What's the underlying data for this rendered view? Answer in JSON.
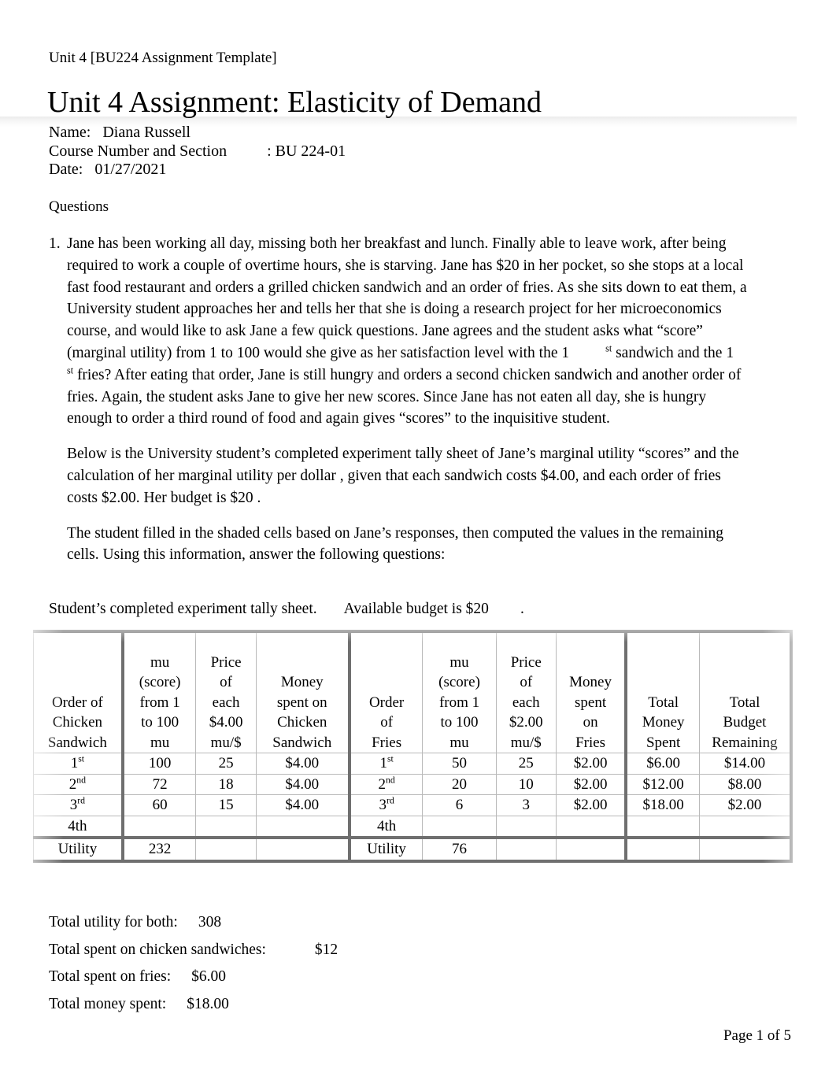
{
  "document": {
    "header_line": "Unit 4 [BU224 Assignment Template]",
    "title": "Unit 4 Assignment: Elasticity of Demand",
    "name_label": "Name:",
    "name_value": "Diana Russell",
    "course_label": "Course Number and Section",
    "course_value": ": BU 224-01",
    "date_label": "Date:",
    "date_value": "01/27/2021",
    "questions_label": "Questions",
    "footer": "Page 1 of 5"
  },
  "question": {
    "number": "1.",
    "paragraph1_a": "Jane has been working all day, missing both her breakfast and lunch. Finally able to leave work, after being required to work a couple of overtime hours, she is starving. Jane has $20 in her pocket, so she stops at a local fast food restaurant and orders a grilled chicken sandwich and an order of fries. As she sits down to eat them, a University student approaches her and tells her that she is doing a research project for her microeconomics course, and would like to ask Jane a few quick questions. Jane agrees and the student asks what “score” (marginal utility) from 1 to 100 would she give as her satisfaction level with the 1",
    "sup1": "st",
    "paragraph1_b": "sandwich and the 1",
    "sup2": "st",
    "paragraph1_c": "fries? After eating that order, Jane is still hungry and orders a second chicken sandwich and another order of fries. Again, the student asks Jane to give her new scores. Since Jane has not eaten all day, she is hungry enough to order a third round of food and again gives “scores” to the inquisitive student.",
    "paragraph2": "Below is the University student’s completed experiment tally sheet of Jane’s marginal utility “scores” and the calculation of her      marginal utility    per dollar  , given that each sandwich costs $4.00, and each order of fries costs $2.00. Her        budget is $20   .",
    "paragraph3": "The student filled in the shaded cells based on Jane’s responses, then computed the values in the remaining cells. Using this information, answer the following questions:"
  },
  "tally_caption": {
    "part1": "Student’s completed experiment tally sheet.",
    "part2": "Available budget is $20",
    "part3": "."
  },
  "table": {
    "headers": {
      "order_of_chicken_sandwich": [
        "Order of",
        "Chicken",
        "Sandwich"
      ],
      "mu_score_chicken": [
        "mu",
        "(score)",
        "from 1",
        "to 100",
        "mu"
      ],
      "price_each_chicken": [
        "Price",
        "of",
        "each",
        "$4.00",
        "mu/$"
      ],
      "money_spent_chicken": [
        "Money",
        "spent on",
        "Chicken",
        "Sandwich"
      ],
      "order_of_fries": [
        "Order",
        "of",
        "Fries"
      ],
      "mu_score_fries": [
        "mu",
        "(score)",
        "from 1",
        "to 100",
        "mu"
      ],
      "price_each_fries": [
        "Price",
        "of",
        "each",
        "$2.00",
        "mu/$"
      ],
      "money_spent_fries": [
        "Money",
        "spent",
        "on",
        "Fries"
      ],
      "total_money_spent": [
        "Total",
        "Money",
        "Spent"
      ],
      "total_budget_remaining": [
        "Total",
        "Budget",
        "Remaining"
      ]
    },
    "rows": [
      {
        "order_chicken": "1",
        "order_chicken_sup": "st",
        "mu_chicken": "100",
        "mu_per_dollar_chicken": "25",
        "money_chicken": "$4.00",
        "order_fries": "1",
        "order_fries_sup": "st",
        "mu_fries": "50",
        "mu_per_dollar_fries": "25",
        "money_fries": "$2.00",
        "total_spent": "$6.00",
        "budget_remaining": "$14.00"
      },
      {
        "order_chicken": "2",
        "order_chicken_sup": "nd",
        "mu_chicken": "72",
        "mu_per_dollar_chicken": "18",
        "money_chicken": "$4.00",
        "order_fries": "2",
        "order_fries_sup": "nd",
        "mu_fries": "20",
        "mu_per_dollar_fries": "10",
        "money_fries": "$2.00",
        "total_spent": "$12.00",
        "budget_remaining": "$8.00"
      },
      {
        "order_chicken": "3",
        "order_chicken_sup": "rd",
        "mu_chicken": "60",
        "mu_per_dollar_chicken": "15",
        "money_chicken": "$4.00",
        "order_fries": "3",
        "order_fries_sup": "rd",
        "mu_fries": "6",
        "mu_per_dollar_fries": "3",
        "money_fries": "$2.00",
        "total_spent": "$18.00",
        "budget_remaining": "$2.00"
      },
      {
        "order_chicken": "4th",
        "order_chicken_sup": "",
        "mu_chicken": "",
        "mu_per_dollar_chicken": "",
        "money_chicken": "",
        "order_fries": "4th",
        "order_fries_sup": "",
        "mu_fries": "",
        "mu_per_dollar_fries": "",
        "money_fries": "",
        "total_spent": "",
        "budget_remaining": ""
      }
    ],
    "utility_row": {
      "label_chicken": "Utility",
      "total_chicken": "232",
      "label_fries": "Utility",
      "total_fries": "76"
    }
  },
  "totals": {
    "utility_both_label": "Total utility for both:",
    "utility_both_value": "308",
    "chicken_label": "Total spent on chicken sandwiches:",
    "chicken_value": "$12",
    "fries_label": "Total spent on fries:",
    "fries_value": "$6.00",
    "money_label": "Total money spent:",
    "money_value": "$18.00"
  }
}
